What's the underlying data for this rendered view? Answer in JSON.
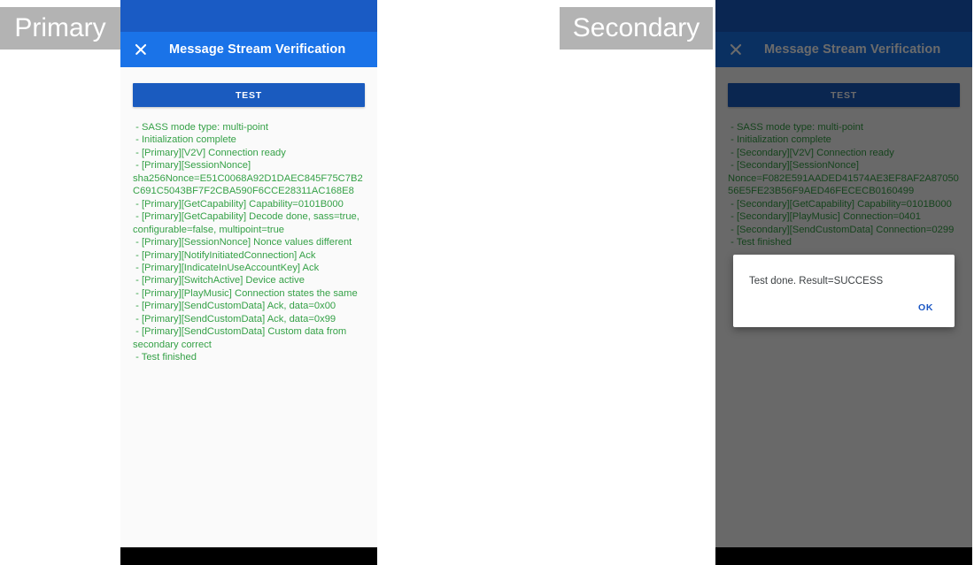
{
  "annotations": {
    "primary_label": "Primary",
    "secondary_label": "Secondary"
  },
  "primary": {
    "app_bar": {
      "close_icon": "close-icon",
      "title": "Message Stream Verification",
      "bar_color": "#1a73e8",
      "status_bar_color": "#1a5bc4"
    },
    "test_button": {
      "label": "TEST",
      "color": "#1a5bbf",
      "enabled": true
    },
    "log": {
      "color": "#35a147",
      "lines": [
        "- SASS mode type: multi-point",
        "- Initialization complete",
        "- [Primary][V2V] Connection ready",
        "- [Primary][SessionNonce] sha256Nonce=E51C0068A92D1DAEC845F75C7B2C691C5043BF7F2CBA590F6CCE28311AC168E8",
        "- [Primary][GetCapability] Capability=0101B000",
        "- [Primary][GetCapability] Decode done, sass=true, configurable=false, multipoint=true",
        "- [Primary][SessionNonce] Nonce values different",
        "- [Primary][NotifyInitiatedConnection] Ack",
        "- [Primary][IndicateInUseAccountKey] Ack",
        "- [Primary][SwitchActive] Device active",
        "- [Primary][PlayMusic] Connection states the same",
        "- [Primary][SendCustomData] Ack, data=0x00",
        "- [Primary][SendCustomData] Ack, data=0x99",
        "- [Primary][SendCustomData] Custom data from secondary correct",
        "- Test finished"
      ]
    }
  },
  "secondary": {
    "app_bar": {
      "close_icon": "close-icon",
      "title": "Message Stream Verification",
      "bar_color": "#1a73e8",
      "status_bar_color": "#1a5bc4"
    },
    "test_button": {
      "label": "TEST",
      "color": "#1a5bbf",
      "enabled": false
    },
    "log": {
      "color": "#35a147",
      "lines": [
        "- SASS mode type: multi-point",
        "- Initialization complete",
        "- [Secondary][V2V] Connection ready",
        "- [Secondary][SessionNonce] Nonce=F082E591AADED41574AE3EF8AF2A8705056E5FE23B56F9AED46FECECB0160499",
        "- [Secondary][GetCapability] Capability=0101B000",
        "- [Secondary][PlayMusic] Connection=0401",
        "- [Secondary][SendCustomData] Connection=0299",
        "- Test finished"
      ]
    },
    "dialog": {
      "message": "Test done. Result=SUCCESS",
      "ok_label": "OK",
      "ok_color": "#1a56c4"
    }
  }
}
